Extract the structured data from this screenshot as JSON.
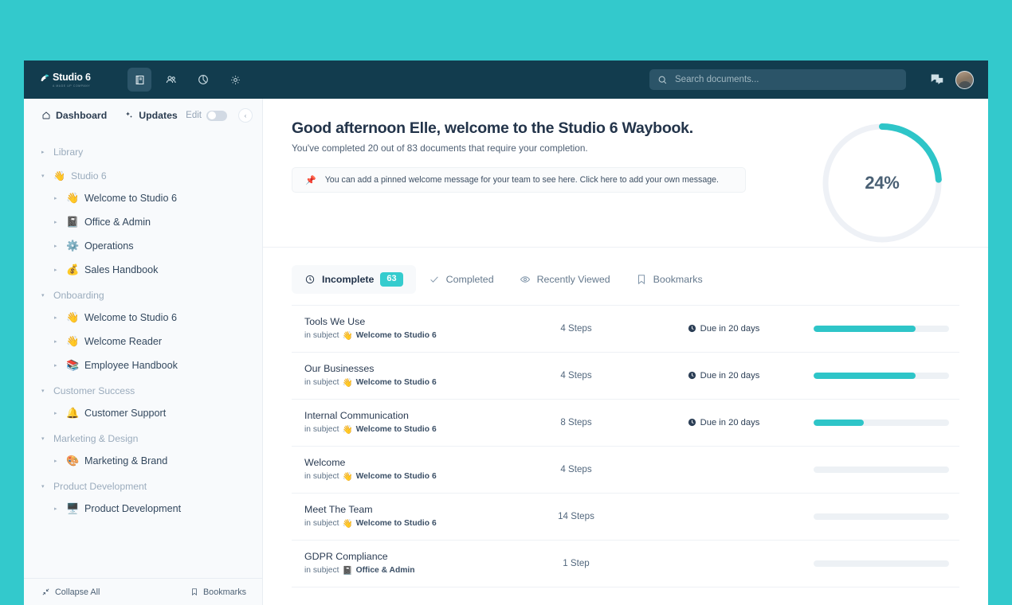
{
  "theme": {
    "page_bg": "#33c9cc",
    "header_bg": "#123c4e",
    "accent_teal": "#2ec5c8",
    "badge_teal": "#35ccce",
    "text_dark": "#23344a"
  },
  "header": {
    "logo_word": "Studio 6",
    "logo_tagline": "A MADE UP COMPANY",
    "nav": [
      {
        "name": "book-icon",
        "label": "Documents",
        "active": true
      },
      {
        "name": "people-icon",
        "label": "People",
        "active": false
      },
      {
        "name": "pie-chart-icon",
        "label": "Reports",
        "active": false
      },
      {
        "name": "gear-icon",
        "label": "Settings",
        "active": false
      }
    ],
    "search": {
      "placeholder": "Search documents...",
      "value": ""
    },
    "chat_icon": "chat-icon",
    "avatar": "user-avatar"
  },
  "sidebar": {
    "top": {
      "dashboard_label": "Dashboard",
      "updates_label": "Updates",
      "edit_label": "Edit",
      "edit_on": false,
      "collapse_chevron": "‹"
    },
    "groups": [
      {
        "section": "Library",
        "section_emoji": "",
        "expanded": false,
        "items": []
      },
      {
        "section": "Studio 6",
        "section_emoji": "👋",
        "expanded": true,
        "items": [
          {
            "emoji": "👋",
            "label": "Welcome to Studio 6"
          },
          {
            "emoji": "📓",
            "label": "Office & Admin"
          },
          {
            "emoji": "⚙️",
            "label": "Operations"
          },
          {
            "emoji": "💰",
            "label": "Sales Handbook"
          }
        ]
      },
      {
        "section": "Onboarding",
        "section_emoji": "",
        "expanded": true,
        "items": [
          {
            "emoji": "👋",
            "label": "Welcome to Studio 6"
          },
          {
            "emoji": "👋",
            "label": "Welcome Reader"
          },
          {
            "emoji": "📚",
            "label": "Employee Handbook"
          }
        ]
      },
      {
        "section": "Customer Success",
        "section_emoji": "",
        "expanded": true,
        "items": [
          {
            "emoji": "🔔",
            "label": "Customer Support"
          }
        ]
      },
      {
        "section": "Marketing & Design",
        "section_emoji": "",
        "expanded": true,
        "items": [
          {
            "emoji": "🎨",
            "label": "Marketing & Brand"
          }
        ]
      },
      {
        "section": "Product Development",
        "section_emoji": "",
        "expanded": true,
        "items": [
          {
            "emoji": "🖥️",
            "label": "Product Development"
          }
        ]
      }
    ],
    "footer": {
      "collapse_all": "Collapse All",
      "bookmarks": "Bookmarks"
    }
  },
  "main": {
    "greeting": "Good afternoon Elle, welcome to the Studio 6 Waybook.",
    "subgreeting": "You've completed 20 out of 83 documents that require your completion.",
    "pinned_message": "You can add a pinned welcome message for your team to see here. Click here to add your own message.",
    "progress": {
      "percent_label": "24%",
      "percent_value": 24
    },
    "tabs": [
      {
        "icon": "clock-icon",
        "label": "Incomplete",
        "badge": "63",
        "active": true
      },
      {
        "icon": "check-icon",
        "label": "Completed",
        "badge": "",
        "active": false
      },
      {
        "icon": "eye-icon",
        "label": "Recently Viewed",
        "badge": "",
        "active": false
      },
      {
        "icon": "bookmark-icon",
        "label": "Bookmarks",
        "badge": "",
        "active": false
      }
    ],
    "documents": [
      {
        "title": "Tools We Use",
        "subject_prefix": "in subject",
        "subject_emoji": "👋",
        "subject": "Welcome to Studio 6",
        "steps": "4 Steps",
        "due": "Due in 20 days",
        "progress_percent": 75
      },
      {
        "title": "Our Businesses",
        "subject_prefix": "in subject",
        "subject_emoji": "👋",
        "subject": "Welcome to Studio 6",
        "steps": "4 Steps",
        "due": "Due in 20 days",
        "progress_percent": 75
      },
      {
        "title": "Internal Communication",
        "subject_prefix": "in subject",
        "subject_emoji": "👋",
        "subject": "Welcome to Studio 6",
        "steps": "8 Steps",
        "due": "Due in 20 days",
        "progress_percent": 37
      },
      {
        "title": "Welcome",
        "subject_prefix": "in subject",
        "subject_emoji": "👋",
        "subject": "Welcome to Studio 6",
        "steps": "4 Steps",
        "due": "",
        "progress_percent": 0
      },
      {
        "title": "Meet The Team",
        "subject_prefix": "in subject",
        "subject_emoji": "👋",
        "subject": "Welcome to Studio 6",
        "steps": "14 Steps",
        "due": "",
        "progress_percent": 0
      },
      {
        "title": "GDPR Compliance",
        "subject_prefix": "in subject",
        "subject_emoji": "📓",
        "subject": "Office & Admin",
        "steps": "1 Step",
        "due": "",
        "progress_percent": 0
      }
    ]
  }
}
